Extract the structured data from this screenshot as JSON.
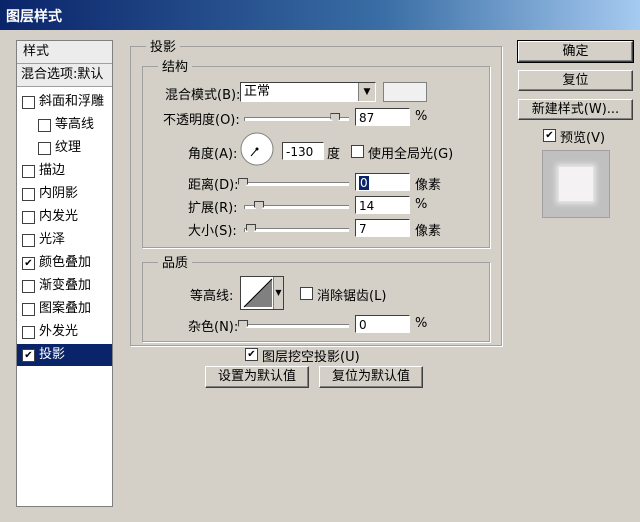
{
  "window": {
    "title": "图层样式"
  },
  "left_panel": {
    "header": "样式",
    "blend_options": "混合选项:默认",
    "items": [
      {
        "label": "斜面和浮雕",
        "checked": false
      },
      {
        "label": "等高线",
        "checked": false
      },
      {
        "label": "纹理",
        "checked": false
      },
      {
        "label": "描边",
        "checked": false
      },
      {
        "label": "内阴影",
        "checked": false
      },
      {
        "label": "内发光",
        "checked": false
      },
      {
        "label": "光泽",
        "checked": false
      },
      {
        "label": "颜色叠加",
        "checked": true
      },
      {
        "label": "渐变叠加",
        "checked": false
      },
      {
        "label": "图案叠加",
        "checked": false
      },
      {
        "label": "外发光",
        "checked": false
      },
      {
        "label": "投影",
        "checked": true
      }
    ]
  },
  "drop_shadow": {
    "title": "投影",
    "structure": {
      "title": "结构",
      "blend_mode_label": "混合模式(B):",
      "blend_mode_value": "正常",
      "opacity_label": "不透明度(O):",
      "opacity_value": "87",
      "opacity_unit": "%",
      "opacity_level": 0.87,
      "angle_label": "角度(A):",
      "angle_value": "-130",
      "angle_unit": "度",
      "global_light_label": "使用全局光(G)",
      "global_light_checked": false,
      "distance_label": "距离(D):",
      "distance_value": "0",
      "distance_unit": "像素",
      "spread_label": "扩展(R):",
      "spread_value": "14",
      "spread_unit": "%",
      "size_label": "大小(S):",
      "size_value": "7",
      "size_unit": "像素"
    },
    "quality": {
      "title": "品质",
      "contour_label": "等高线:",
      "antialias_label": "消除锯齿(L)",
      "antialias_checked": false,
      "noise_label": "杂色(N):",
      "noise_value": "0",
      "noise_unit": "%"
    },
    "knockout_label": "图层挖空投影(U)",
    "knockout_checked": true,
    "make_default": "设置为默认值",
    "reset_default": "复位为默认值"
  },
  "buttons": {
    "ok": "确定",
    "reset": "复位",
    "new_style": "新建样式(W)...",
    "preview_label": "预览(V)",
    "preview_checked": true
  },
  "checkmark": "✔"
}
